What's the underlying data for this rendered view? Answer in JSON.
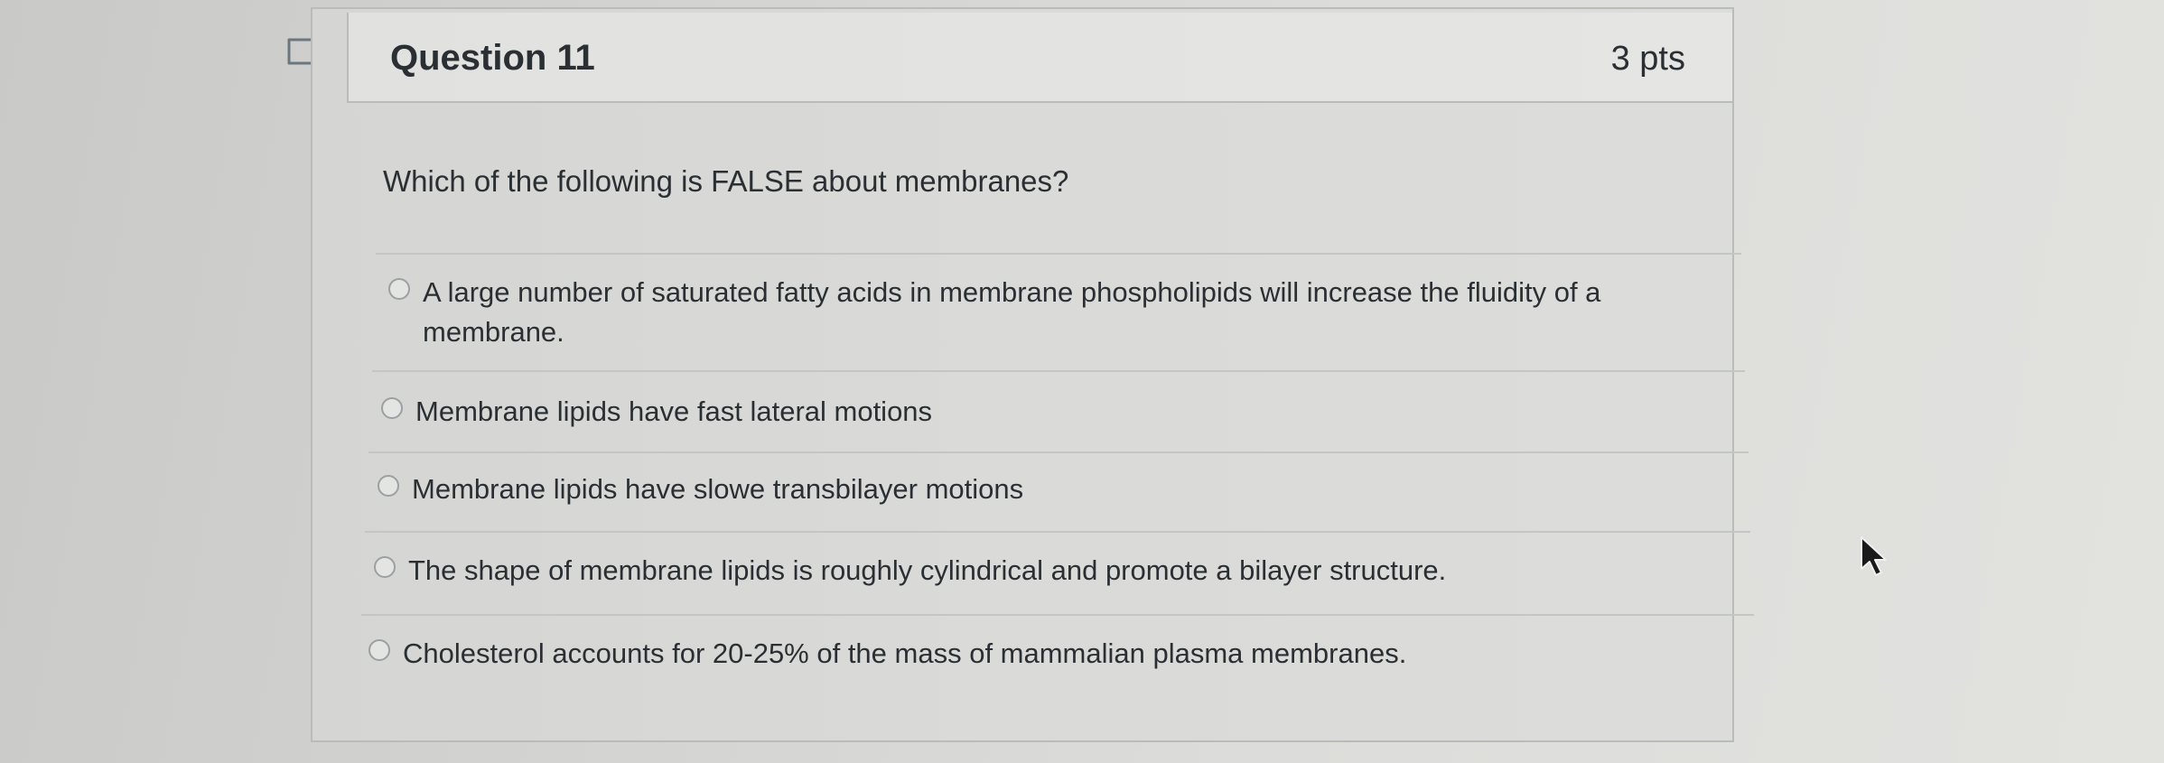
{
  "question": {
    "title": "Question 11",
    "points": "3 pts",
    "text": "Which of the following is FALSE about membranes?"
  },
  "answers": [
    {
      "label": "A large number of saturated fatty acids in membrane phospholipids will increase the fluidity of a",
      "label_line2": "membrane."
    },
    {
      "label": "Membrane lipids have fast lateral motions"
    },
    {
      "label": "Membrane lipids have slowe transbilayer motions"
    },
    {
      "label": "The shape of membrane lipids is roughly cylindrical and promote a bilayer structure."
    },
    {
      "label": "Cholesterol accounts for 20-25% of the mass of mammalian plasma membranes."
    }
  ],
  "icons": {
    "flag": "flag-icon",
    "radio": "radio-icon",
    "cursor": "mouse-pointer-icon"
  },
  "colors": {
    "text": "#2a2f33",
    "border": "#b9bcbd"
  }
}
